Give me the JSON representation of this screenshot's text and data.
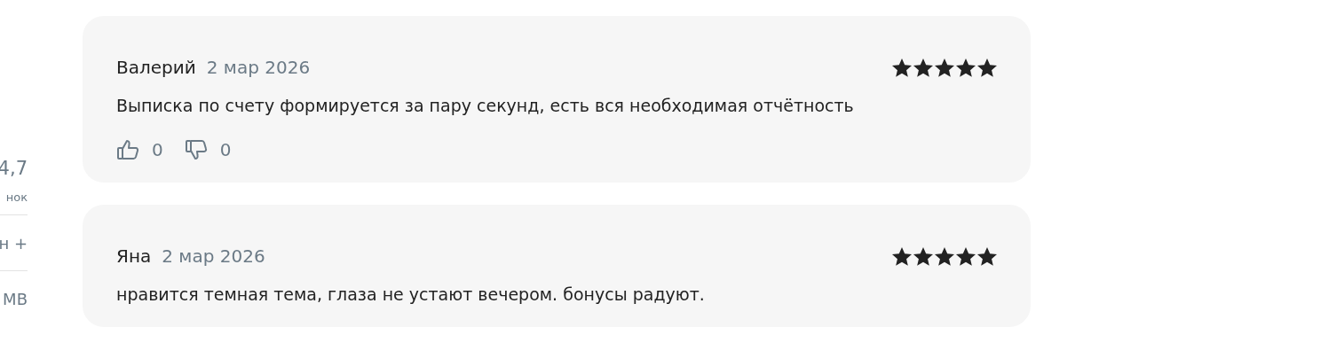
{
  "sidebar": {
    "rating": "4,7",
    "rating_caption": "нок",
    "rows": [
      "н +",
      "MB"
    ]
  },
  "reviews": [
    {
      "author": "Валерий",
      "date": "2 мар 2026",
      "stars": 5,
      "text": "Выписка по счету формируется за пару секунд, есть вся необходимая отчётность",
      "likes": "0",
      "dislikes": "0"
    },
    {
      "author": "Яна",
      "date": "2 мар 2026",
      "stars": 5,
      "text": "нравится темная тема, глаза не устают вечером. бонусы радуют."
    }
  ]
}
